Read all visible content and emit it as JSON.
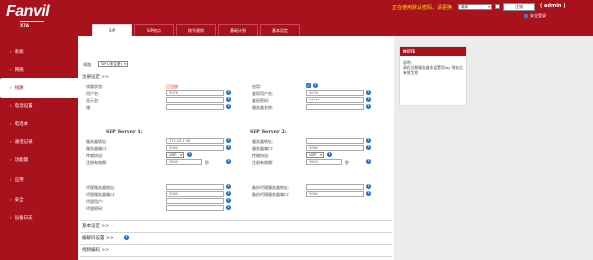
{
  "header": {
    "logo": "Fanvil",
    "model": "X7A",
    "warning": "正在使用默认密码，请更换",
    "language": "简体",
    "logout": "注销",
    "user": "( admin )",
    "secure_login": "安全登录"
  },
  "tabs": [
    {
      "label": "SIP",
      "active": true
    },
    {
      "label": "SIP热点",
      "active": false
    },
    {
      "label": "拨号规则",
      "active": false
    },
    {
      "label": "基础计划",
      "active": false
    },
    {
      "label": "基本设定",
      "active": false
    }
  ],
  "sidebar": {
    "items": [
      {
        "label": "系统",
        "active": false
      },
      {
        "label": "网络",
        "active": false
      },
      {
        "label": "线路",
        "active": true
      },
      {
        "label": "电话设置",
        "active": false
      },
      {
        "label": "电话本",
        "active": false
      },
      {
        "label": "通话记录",
        "active": false
      },
      {
        "label": "功能键",
        "active": false
      },
      {
        "label": "应用",
        "active": false
      },
      {
        "label": "安全",
        "active": false
      },
      {
        "label": "设备日志",
        "active": false
      }
    ]
  },
  "line": {
    "label": "线路",
    "value": "SIP1(未注册)"
  },
  "register": {
    "title": "注册设定 >>",
    "status_label": "线路状态:",
    "status_value": "已注册",
    "username_label": "用户名:",
    "username_value": "5076",
    "display_label": "显示名:",
    "display_value": "",
    "realm_label": "域:",
    "realm_value": "",
    "enable_label": "启用:",
    "auth_user_label": "鉴权用户名:",
    "auth_user_value": "5076",
    "auth_pwd_label": "鉴权密码:",
    "auth_pwd_value": "•••••",
    "server_name_label": "服务器名称:",
    "server_name_value": ""
  },
  "sip1": {
    "title": "SIP Server 1:",
    "addr_label": "服务器地址:",
    "addr_value": "172.16.1.36",
    "port_label": "服务器端口:",
    "port_value": "5060",
    "transport_label": "传输协议:",
    "transport_value": "UDP",
    "expires_label": "注册有效期:",
    "expires_value": "3600",
    "expires_unit": "秒"
  },
  "sip2": {
    "title": "SIP Server 2:",
    "addr_label": "服务器地址:",
    "addr_value": "",
    "port_label": "服务器端口:",
    "port_value": "5060",
    "transport_label": "传输协议:",
    "transport_value": "UDP",
    "expires_label": "注册有效期:",
    "expires_value": "3600",
    "expires_unit": "秒"
  },
  "proxy": {
    "addr_label": "代理服务器地址:",
    "addr_value": "",
    "port_label": "代理服务器端口:",
    "port_value": "5060",
    "user_label": "代理用户:",
    "user_value": "",
    "pwd_label": "代理密码:",
    "pwd_value": "",
    "backup_addr_label": "备份代理服务器地址:",
    "backup_addr_value": "",
    "backup_port_label": "备份代理服务器端口:",
    "backup_port_value": "5060"
  },
  "sections": {
    "basic": "基本设定 >>",
    "codec": "编解码设置 >>",
    "video": "视频编码 >>"
  },
  "note": {
    "title": "NOTE",
    "heading": "说明:",
    "body": "请在注册服务器本设置项lay 保存后有效生效"
  },
  "colors": {
    "brand": "#a8121c",
    "help": "#1f6fd0",
    "status_warning": "#ffe000",
    "error": "#e02020"
  }
}
